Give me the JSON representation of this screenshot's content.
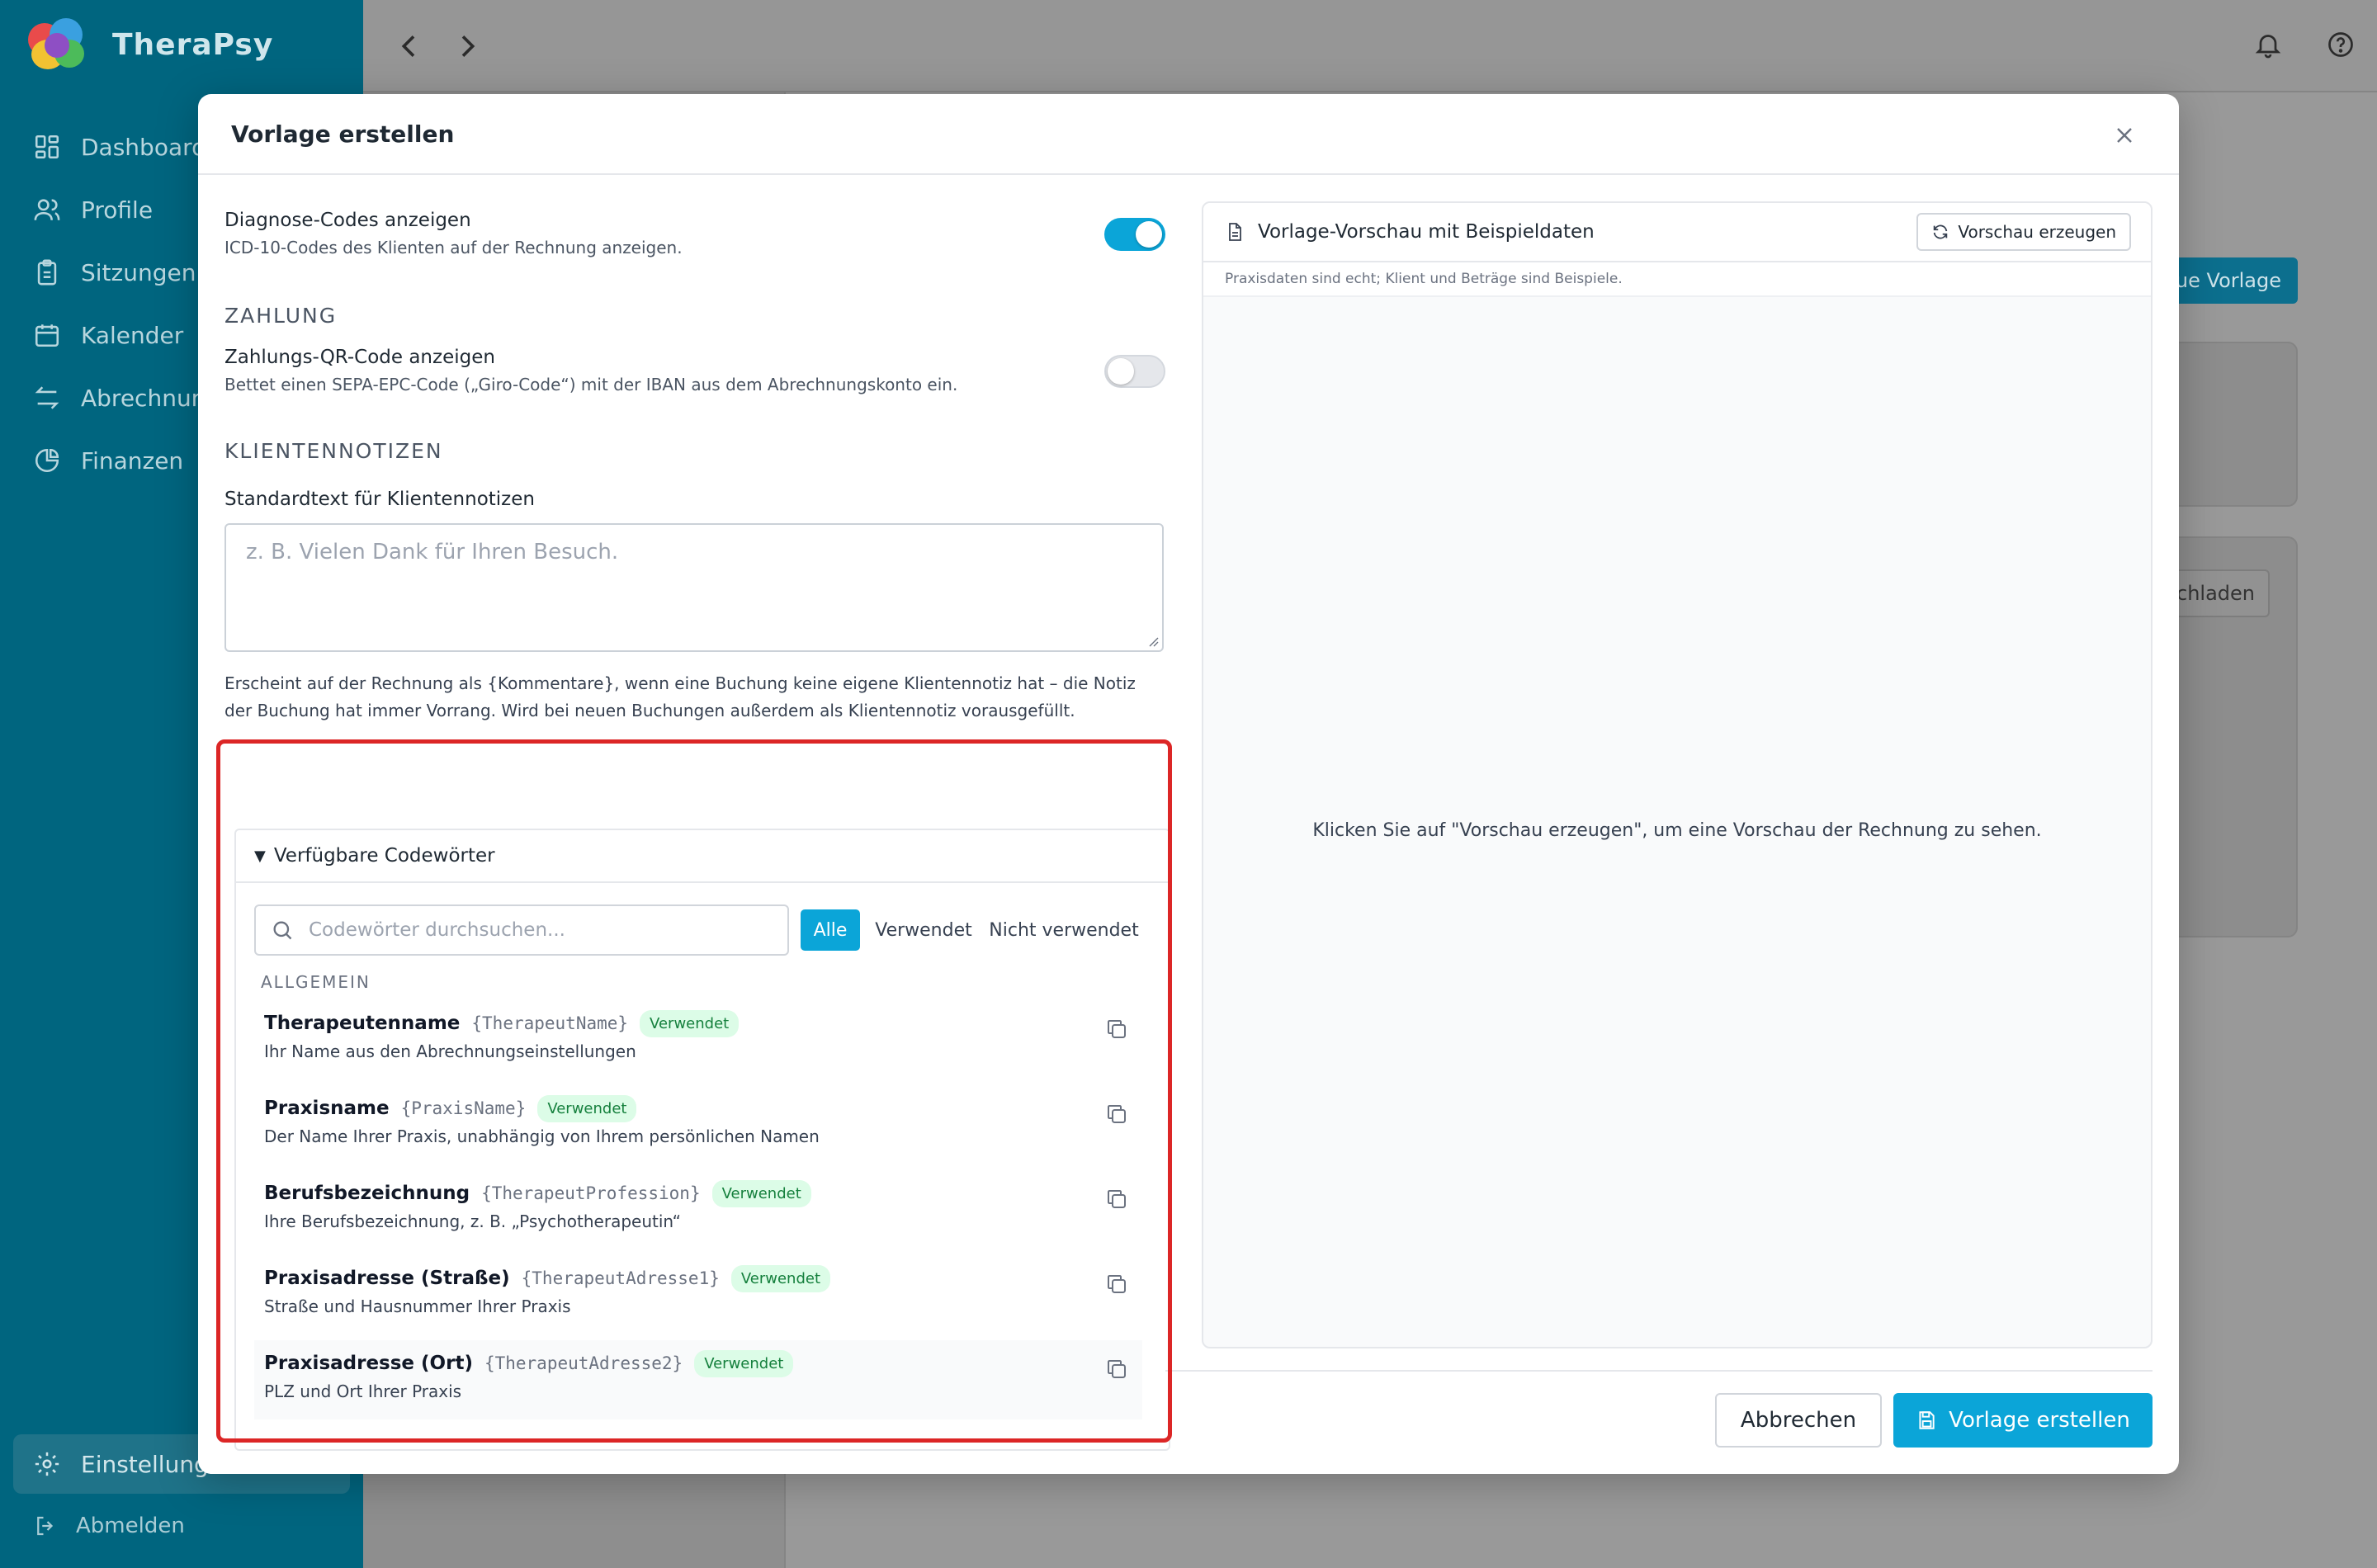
{
  "app": {
    "name": "TheraPsy",
    "nav": [
      {
        "label": "Dashboard",
        "icon": "dashboard-icon"
      },
      {
        "label": "Profile",
        "icon": "users-icon"
      },
      {
        "label": "Sitzungen",
        "icon": "clipboard-icon"
      },
      {
        "label": "Kalender",
        "icon": "calendar-icon"
      },
      {
        "label": "Abrechnung",
        "icon": "transfer-icon"
      },
      {
        "label": "Finanzen",
        "icon": "pie-chart-icon"
      }
    ],
    "settings_label": "Einstellungen",
    "logout_label": "Abmelden",
    "bg_new_template_button": "ue Vorlage",
    "bg_download_button": "chladen"
  },
  "modal": {
    "title": "Vorlage erstellen",
    "diagnose": {
      "title": "Diagnose-Codes anzeigen",
      "desc": "ICD-10-Codes des Klienten auf der Rechnung anzeigen.",
      "enabled": true
    },
    "payment_section": "ZAHLUNG",
    "qr": {
      "title": "Zahlungs-QR-Code anzeigen",
      "desc": "Bettet einen SEPA-EPC-Code („Giro-Code“) mit der IBAN aus dem Abrechnungskonto ein.",
      "enabled": false
    },
    "notes_section": "KLIENTENNOTIZEN",
    "notes_label": "Standardtext für Klientennotizen",
    "notes_placeholder": "z. B. Vielen Dank für Ihren Besuch.",
    "notes_help": "Erscheint auf der Rechnung als {Kommentare}, wenn eine Buchung keine eigene Klientennotiz hat – die Notiz der Buchung hat immer Vorrang. Wird bei neuen Buchungen außerdem als Klientennotiz vorausgefüllt.",
    "codewords": {
      "title": "Verfügbare Codewörter",
      "search_placeholder": "Codewörter durchsuchen...",
      "filters": [
        "Alle",
        "Verwendet",
        "Nicht verwendet"
      ],
      "active_filter": "Alle",
      "group": "ALLGEMEIN",
      "items": [
        {
          "name": "Therapeutenname",
          "token": "{TherapeutName}",
          "status": "Verwendet",
          "desc": "Ihr Name aus den Abrechnungseinstellungen"
        },
        {
          "name": "Praxisname",
          "token": "{PraxisName}",
          "status": "Verwendet",
          "desc": "Der Name Ihrer Praxis, unabhängig von Ihrem persönlichen Namen"
        },
        {
          "name": "Berufsbezeichnung",
          "token": "{TherapeutProfession}",
          "status": "Verwendet",
          "desc": "Ihre Berufsbezeichnung, z. B. „Psychotherapeutin“"
        },
        {
          "name": "Praxisadresse (Straße)",
          "token": "{TherapeutAdresse1}",
          "status": "Verwendet",
          "desc": "Straße und Hausnummer Ihrer Praxis"
        },
        {
          "name": "Praxisadresse (Ort)",
          "token": "{TherapeutAdresse2}",
          "status": "Verwendet",
          "desc": "PLZ und Ort Ihrer Praxis"
        }
      ]
    },
    "preview": {
      "title": "Vorlage-Vorschau mit Beispieldaten",
      "button": "Vorschau erzeugen",
      "subtitle": "Praxisdaten sind echt; Klient und Beträge sind Beispiele.",
      "empty": "Klicken Sie auf \"Vorschau erzeugen\", um eine Vorschau der Rechnung zu sehen."
    },
    "cancel_label": "Abbrechen",
    "create_label": "Vorlage erstellen"
  },
  "colors": {
    "sidebar": "#00657f",
    "accent": "#0ba5d8",
    "badge_bg": "#dcfce7",
    "badge_text": "#15803d",
    "highlight": "#dc2626"
  }
}
